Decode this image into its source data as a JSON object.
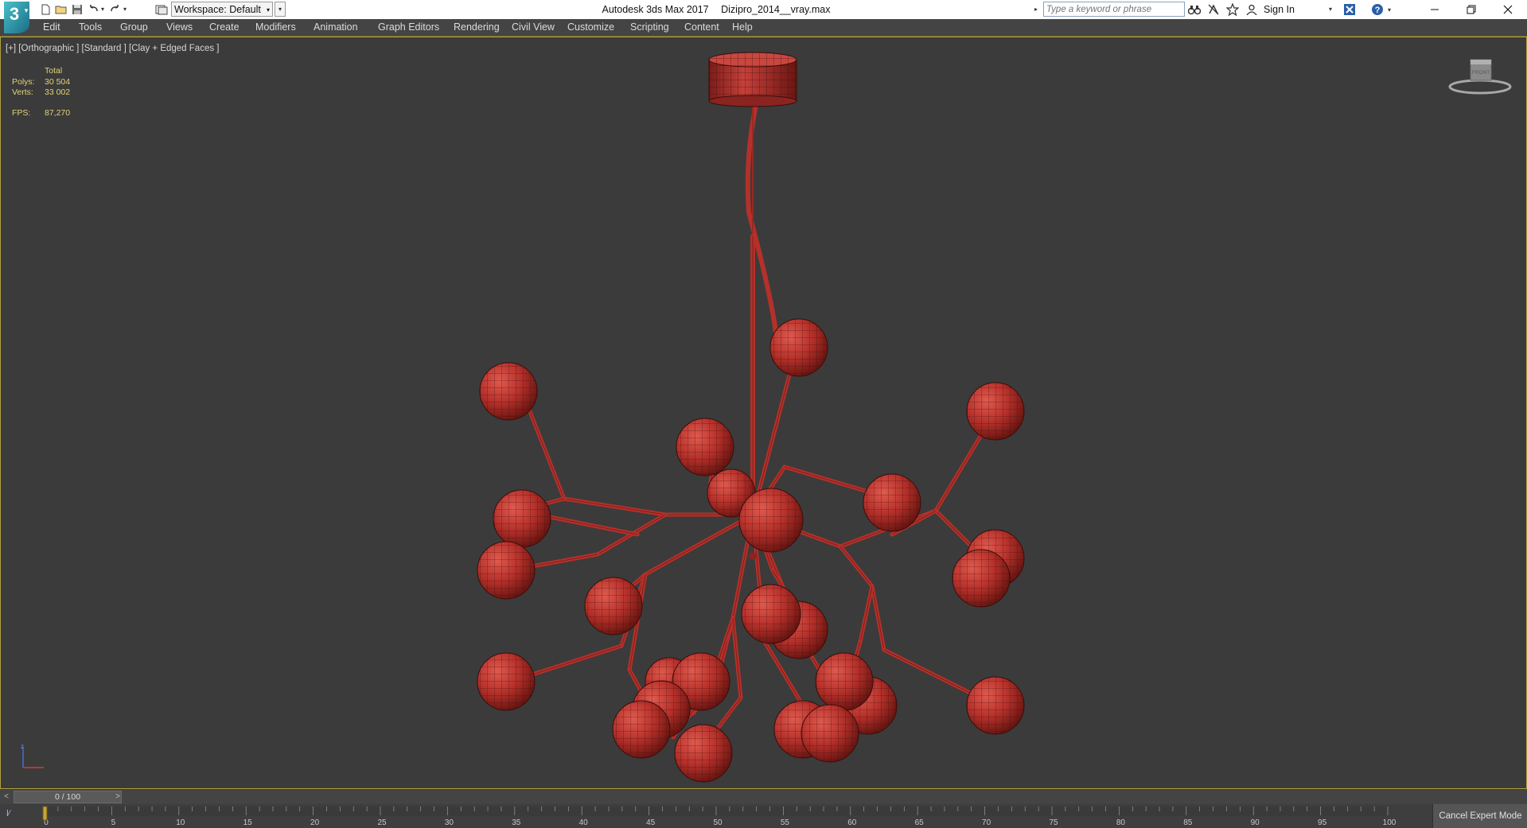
{
  "window": {
    "app_name": "Autodesk 3ds Max 2017",
    "file_name": "Dizipro_2014__vray.max"
  },
  "titlebar": {
    "workspace_label": "Workspace: Default",
    "search_placeholder": "Type a keyword or phrase",
    "signin_label": "Sign In",
    "window_controls": [
      "minimize-icon",
      "restore-icon",
      "close-icon"
    ]
  },
  "menubar": {
    "items": [
      "Edit",
      "Tools",
      "Group",
      "Views",
      "Create",
      "Modifiers",
      "Animation",
      "Graph Editors",
      "Rendering",
      "Civil View",
      "Customize",
      "Scripting",
      "Content",
      "Help"
    ]
  },
  "viewport": {
    "label": "[+] [Orthographic ] [Standard ] [Clay + Edged Faces ]",
    "stats": {
      "header": "Total",
      "polys_label": "Polys:",
      "polys_value": "30 504",
      "verts_label": "Verts:",
      "verts_value": "33 002",
      "fps_label": "FPS:",
      "fps_value": "87,270"
    },
    "viewcube_label": "FRONT",
    "mesh_color": "#b5302a",
    "background_color": "#3b3b3b"
  },
  "timeline": {
    "slider_label": "0 / 100",
    "ruler_start": 0,
    "ruler_end": 100,
    "ruler_label_step": 5,
    "cancel_label": "Cancel Expert Mode"
  }
}
